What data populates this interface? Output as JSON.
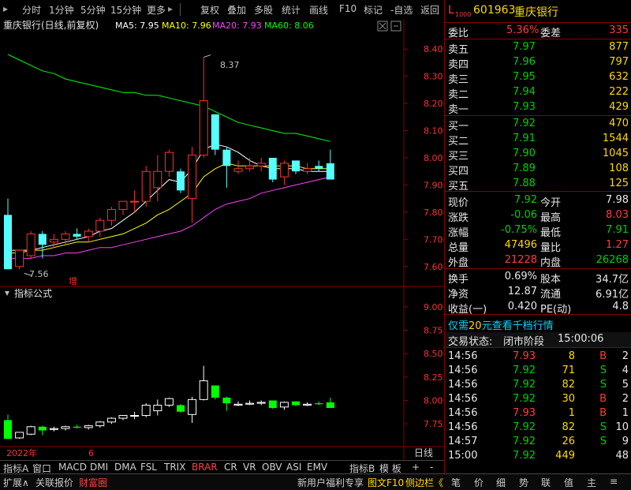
{
  "toolbar": {
    "items": [
      "分时",
      "1分钟",
      "5分钟",
      "15分钟",
      "更多",
      "复权",
      "叠加",
      "多股",
      "统计",
      "画线",
      "F10",
      "标记",
      "-自选",
      "返回"
    ],
    "more_arrow": "▸"
  },
  "main_chart": {
    "title": "重庆银行(日线,前复权)",
    "ma_labels": [
      {
        "text": "MA5: 7.95",
        "color": "#ffffff"
      },
      {
        "text": "MA10: 7.96",
        "color": "#ffff00"
      },
      {
        "text": "MA20: 7.93",
        "color": "#ff40ff"
      },
      {
        "text": "MA60: 8.06",
        "color": "#00ff00"
      }
    ],
    "y_labels": [
      "8.40",
      "8.30",
      "8.20",
      "8.10",
      "8.00",
      "7.90",
      "7.80",
      "7.70",
      "7.60"
    ],
    "high_label": "8.37",
    "low_label": "7.56",
    "event_marker": "增"
  },
  "indicator": {
    "title": "指标公式",
    "y_labels": [
      "9.00",
      "8.75",
      "8.50",
      "8.25",
      "8.00",
      "7.75"
    ]
  },
  "x_axis": {
    "year": "2022年",
    "month": "6",
    "period": "日线"
  },
  "chart_data": {
    "type": "candlestick",
    "ylim": [
      7.55,
      8.45
    ],
    "candles": [
      {
        "o": 7.79,
        "h": 7.85,
        "l": 7.59,
        "c": 7.59
      },
      {
        "o": 7.6,
        "h": 7.66,
        "l": 7.59,
        "c": 7.66
      },
      {
        "o": 7.64,
        "h": 7.73,
        "l": 7.63,
        "c": 7.72
      },
      {
        "o": 7.72,
        "h": 7.73,
        "l": 7.63,
        "c": 7.68
      },
      {
        "o": 7.69,
        "h": 7.72,
        "l": 7.67,
        "c": 7.7
      },
      {
        "o": 7.7,
        "h": 7.73,
        "l": 7.68,
        "c": 7.72
      },
      {
        "o": 7.72,
        "h": 7.74,
        "l": 7.7,
        "c": 7.71
      },
      {
        "o": 7.71,
        "h": 7.74,
        "l": 7.69,
        "c": 7.73
      },
      {
        "o": 7.73,
        "h": 7.78,
        "l": 7.71,
        "c": 7.77
      },
      {
        "o": 7.77,
        "h": 7.82,
        "l": 7.75,
        "c": 7.81
      },
      {
        "o": 7.81,
        "h": 7.84,
        "l": 7.79,
        "c": 7.84
      },
      {
        "o": 7.84,
        "h": 7.88,
        "l": 7.8,
        "c": 7.84
      },
      {
        "o": 7.84,
        "h": 7.97,
        "l": 7.82,
        "c": 7.95
      },
      {
        "o": 7.89,
        "h": 8.01,
        "l": 7.84,
        "c": 7.95
      },
      {
        "o": 7.95,
        "h": 8.03,
        "l": 7.93,
        "c": 8.02
      },
      {
        "o": 7.95,
        "h": 7.96,
        "l": 7.87,
        "c": 7.88
      },
      {
        "o": 7.85,
        "h": 8.04,
        "l": 7.76,
        "c": 8.01
      },
      {
        "o": 8.01,
        "h": 8.37,
        "l": 8.0,
        "c": 8.21
      },
      {
        "o": 8.16,
        "h": 8.16,
        "l": 8.01,
        "c": 8.03
      },
      {
        "o": 8.03,
        "h": 8.04,
        "l": 7.89,
        "c": 7.97
      },
      {
        "o": 7.95,
        "h": 7.99,
        "l": 7.94,
        "c": 7.96
      },
      {
        "o": 7.96,
        "h": 8.0,
        "l": 7.95,
        "c": 7.97
      },
      {
        "o": 7.97,
        "h": 8.0,
        "l": 7.95,
        "c": 7.98
      },
      {
        "o": 8.0,
        "h": 8.0,
        "l": 7.91,
        "c": 7.92
      },
      {
        "o": 7.93,
        "h": 7.99,
        "l": 7.9,
        "c": 7.98
      },
      {
        "o": 7.99,
        "h": 7.99,
        "l": 7.94,
        "c": 7.95
      },
      {
        "o": 7.95,
        "h": 7.98,
        "l": 7.94,
        "c": 7.96
      },
      {
        "o": 7.97,
        "h": 7.99,
        "l": 7.95,
        "c": 7.96
      },
      {
        "o": 7.98,
        "h": 8.03,
        "l": 7.92,
        "c": 7.92
      }
    ],
    "ma5": [
      7.66,
      7.66,
      7.66,
      7.67,
      7.68,
      7.69,
      7.7,
      7.71,
      7.73,
      7.74,
      7.77,
      7.8,
      7.84,
      7.88,
      7.92,
      7.91,
      7.96,
      8.03,
      8.05,
      8.04,
      8.02,
      7.99,
      7.97,
      7.96,
      7.96,
      7.96,
      7.95,
      7.95,
      7.95
    ],
    "ma10": [
      7.65,
      7.65,
      7.66,
      7.66,
      7.67,
      7.68,
      7.69,
      7.69,
      7.7,
      7.71,
      7.72,
      7.74,
      7.76,
      7.79,
      7.81,
      7.84,
      7.87,
      7.93,
      7.96,
      7.98,
      7.97,
      7.97,
      7.97,
      7.97,
      7.97,
      7.97,
      7.96,
      7.96,
      7.96
    ],
    "ma20": [
      7.63,
      7.63,
      7.63,
      7.64,
      7.64,
      7.65,
      7.65,
      7.66,
      7.67,
      7.67,
      7.68,
      7.69,
      7.7,
      7.71,
      7.72,
      7.73,
      7.75,
      7.78,
      7.81,
      7.83,
      7.84,
      7.85,
      7.87,
      7.88,
      7.89,
      7.9,
      7.91,
      7.92,
      7.93
    ],
    "ma60": [
      8.38,
      8.36,
      8.34,
      8.32,
      8.31,
      8.29,
      8.28,
      8.27,
      8.26,
      8.25,
      8.24,
      8.24,
      8.23,
      8.23,
      8.22,
      8.21,
      8.2,
      8.19,
      8.17,
      8.15,
      8.13,
      8.12,
      8.11,
      8.1,
      8.09,
      8.09,
      8.08,
      8.07,
      8.06
    ]
  },
  "right_panel": {
    "header": {
      "prefix": "L",
      "sub": "1000",
      "code": "601963",
      "name": "重庆银行"
    },
    "ratio": {
      "label1": "委比",
      "val1": "5.36%",
      "label2": "委差",
      "val2": "335"
    },
    "asks": [
      {
        "label": "卖五",
        "price": "7.97",
        "vol": "877"
      },
      {
        "label": "卖四",
        "price": "7.96",
        "vol": "797"
      },
      {
        "label": "卖三",
        "price": "7.95",
        "vol": "632"
      },
      {
        "label": "卖二",
        "price": "7.94",
        "vol": "222"
      },
      {
        "label": "卖一",
        "price": "7.93",
        "vol": "429"
      }
    ],
    "bids": [
      {
        "label": "买一",
        "price": "7.92",
        "vol": "470"
      },
      {
        "label": "买二",
        "price": "7.91",
        "vol": "1544"
      },
      {
        "label": "买三",
        "price": "7.90",
        "vol": "1045"
      },
      {
        "label": "买四",
        "price": "7.89",
        "vol": "108"
      },
      {
        "label": "买五",
        "price": "7.88",
        "vol": "125"
      }
    ],
    "stats1": [
      {
        "l1": "现价",
        "v1": "7.92",
        "c1": "green",
        "l2": "今开",
        "v2": "7.98",
        "c2": "white"
      },
      {
        "l1": "涨跌",
        "v1": "-0.06",
        "c1": "green",
        "l2": "最高",
        "v2": "8.03",
        "c2": "red"
      },
      {
        "l1": "涨幅",
        "v1": "-0.75%",
        "c1": "green",
        "l2": "最低",
        "v2": "7.91",
        "c2": "green"
      },
      {
        "l1": "总量",
        "v1": "47496",
        "c1": "yellow",
        "l2": "量比",
        "v2": "1.27",
        "c2": "red"
      },
      {
        "l1": "外盘",
        "v1": "21228",
        "c1": "red",
        "l2": "内盘",
        "v2": "26268",
        "c2": "green"
      }
    ],
    "stats2": [
      {
        "l1": "换手",
        "v1": "0.69%",
        "l2": "股本",
        "v2": "34.7亿"
      },
      {
        "l1": "净资",
        "v1": "12.87",
        "l2": "流通",
        "v2": "6.91亿"
      },
      {
        "l1": "收益(一)",
        "v1": "0.420",
        "l2": "PE(动)",
        "v2": "4.8"
      }
    ],
    "promo": {
      "pre": "仅需",
      "num": "20",
      "post": "元查看千档行情"
    },
    "status": {
      "label": "交易状态:",
      "value": "闭市阶段",
      "time": "15:00:06"
    },
    "ticks": [
      {
        "t": "14:56",
        "p": "7.93",
        "pc": "red",
        "v": "8",
        "s": "B",
        "sc": "red",
        "n": "2"
      },
      {
        "t": "14:56",
        "p": "7.92",
        "pc": "green",
        "v": "71",
        "s": "S",
        "sc": "green",
        "n": "4"
      },
      {
        "t": "14:56",
        "p": "7.92",
        "pc": "green",
        "v": "82",
        "s": "S",
        "sc": "green",
        "n": "5"
      },
      {
        "t": "14:56",
        "p": "7.92",
        "pc": "green",
        "v": "30",
        "s": "B",
        "sc": "red",
        "n": "2"
      },
      {
        "t": "14:56",
        "p": "7.93",
        "pc": "red",
        "v": "1",
        "s": "B",
        "sc": "red",
        "n": "1"
      },
      {
        "t": "14:56",
        "p": "7.92",
        "pc": "green",
        "v": "82",
        "s": "S",
        "sc": "green",
        "n": "10"
      },
      {
        "t": "14:57",
        "p": "7.92",
        "pc": "green",
        "v": "26",
        "s": "S",
        "sc": "green",
        "n": "9"
      },
      {
        "t": "15:00",
        "p": "7.92",
        "pc": "green",
        "v": "449",
        "s": "",
        "sc": "white",
        "n": "48"
      }
    ]
  },
  "tabs": [
    "指标A",
    "窗口",
    "MACD",
    "DMI",
    "DMA",
    "FSL",
    "TRIX",
    "BRAR",
    "CR",
    "VR",
    "OBV",
    "ASI",
    "EMV",
    "指标B",
    "模 板",
    "+",
    "-"
  ],
  "bottom_bar": {
    "left": [
      "扩展∧",
      "关联报价",
      "财富圈"
    ],
    "right": [
      "新用户福利专享",
      "图文F10",
      "侧边栏《"
    ],
    "right_icons": [
      "笔",
      "价",
      "细",
      "势",
      "联",
      "值",
      "主",
      "≡"
    ]
  }
}
